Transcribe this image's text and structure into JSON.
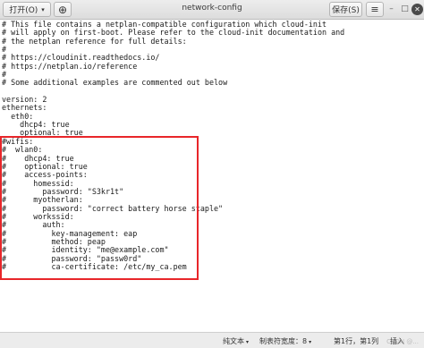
{
  "header": {
    "open_label": "打开(O)",
    "open_chevron": "▾",
    "new_doc_icon": "document-new-icon",
    "new_doc_glyph": "⊕",
    "title": "network-config",
    "save_label": "保存(S)",
    "menu_glyph": "≡",
    "minimize_glyph": "–",
    "maximize_glyph": "□",
    "close_glyph": "✕"
  },
  "editor": {
    "lines": [
      "# This file contains a netplan-compatible configuration which cloud-init",
      "# will apply on first-boot. Please refer to the cloud-init documentation and",
      "# the netplan reference for full details:",
      "#",
      "# https://cloudinit.readthedocs.io/",
      "# https://netplan.io/reference",
      "#",
      "# Some additional examples are commented out below",
      "",
      "version: 2",
      "ethernets:",
      "  eth0:",
      "    dhcp4: true",
      "    optional: true",
      "#wifis:",
      "#  wlan0:",
      "#    dhcp4: true",
      "#    optional: true",
      "#    access-points:",
      "#      homessid:",
      "#        password: \"S3kr1t\"",
      "#      myotherlan:",
      "#        password: \"correct battery horse staple\"",
      "#      workssid:",
      "#        auth:",
      "#          key-management: eap",
      "#          method: peap",
      "#          identity: \"me@example.com\"",
      "#          password: \"passw0rd\"",
      "#          ca-certificate: /etc/my_ca.pem"
    ],
    "highlight_color": "#e8262a"
  },
  "statusbar": {
    "language": "纯文本",
    "tab_width": "制表符宽度：8",
    "position": "第1行，第1列",
    "mode": "插入",
    "caret": "▾"
  },
  "watermark": "CSDN @..."
}
